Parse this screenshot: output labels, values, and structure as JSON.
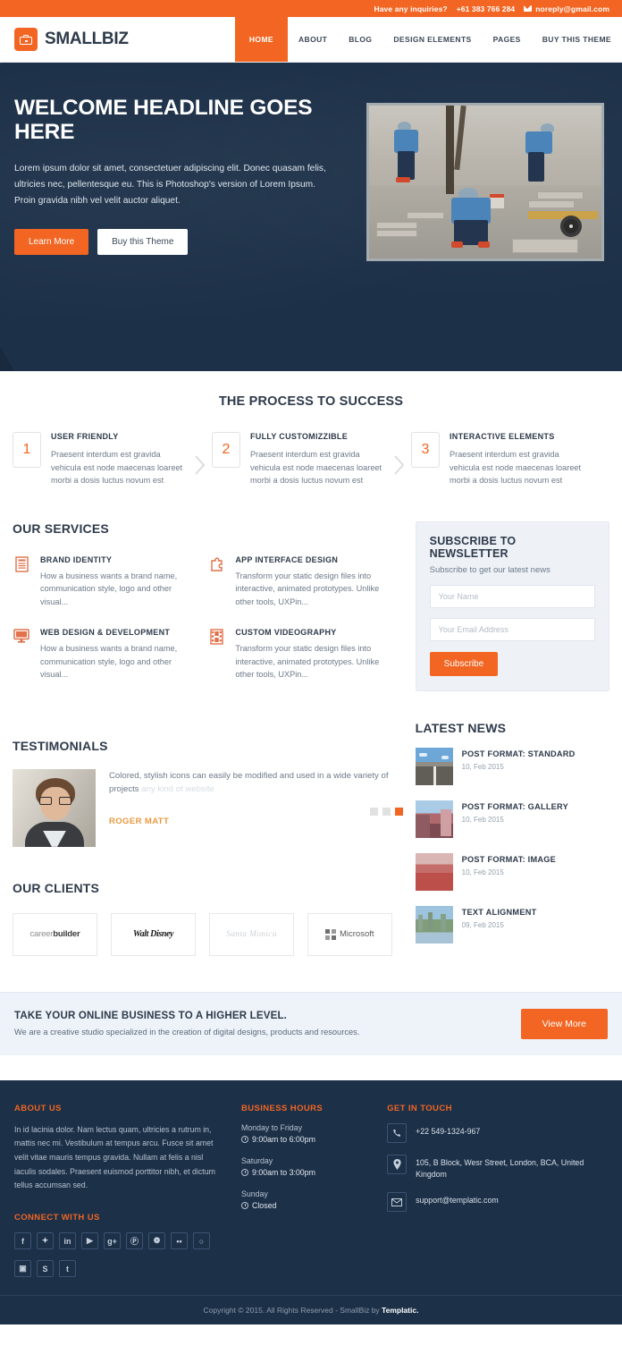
{
  "topbar": {
    "inquiry_label": "Have any inquiries?",
    "phone": "+61 383 766 284",
    "email": "noreply@gmail.com"
  },
  "header": {
    "logo_text": "SMALLBIZ",
    "nav": [
      {
        "label": "HOME",
        "active": true
      },
      {
        "label": "ABOUT",
        "active": false
      },
      {
        "label": "BLOG",
        "active": false
      },
      {
        "label": "DESIGN ELEMENTS",
        "active": false
      },
      {
        "label": "PAGES",
        "active": false
      },
      {
        "label": "BUY THIS THEME",
        "active": false
      }
    ]
  },
  "hero": {
    "title": "WELCOME HEADLINE GOES HERE",
    "description": "Lorem ipsum dolor sit amet, consectetuer adipiscing elit. Donec quasam felis, ultricies nec, pellentesque eu. This is Photoshop's version of Lorem Ipsum. Proin gravida nibh vel velit auctor aliquet.",
    "primary_btn": "Learn More",
    "secondary_btn": "Buy this Theme",
    "image_alt": "construction-workers-laying-pavers"
  },
  "process": {
    "title": "THE PROCESS TO SUCCESS",
    "items": [
      {
        "num": "1",
        "title": "USER FRIENDLY",
        "text": "Praesent interdum est gravida vehicula est node maecenas loareet morbi a dosis luctus novum est"
      },
      {
        "num": "2",
        "title": "FULLY CUSTOMIZZIBLE",
        "text": "Praesent interdum est gravida vehicula est node maecenas loareet morbi a dosis luctus novum est"
      },
      {
        "num": "3",
        "title": "INTERACTIVE ELEMENTS",
        "text": "Praesent interdum est gravida vehicula est node maecenas loareet morbi a dosis luctus novum est"
      }
    ]
  },
  "services": {
    "title": "OUR SERVICES",
    "items": [
      {
        "icon": "document-icon",
        "title": "BRAND IDENTITY",
        "text": "How a business wants a brand name, communication style, logo and other visual..."
      },
      {
        "icon": "puzzle-icon",
        "title": "APP INTERFACE DESIGN",
        "text": "Transform your static design files into interactive, animated prototypes. Unlike other tools, UXPin..."
      },
      {
        "icon": "monitor-icon",
        "title": "WEB DESIGN & DEVELOPMENT",
        "text": "How a business wants a brand name, communication style, logo and other visual..."
      },
      {
        "icon": "filmstrip-icon",
        "title": "CUSTOM VIDEOGRAPHY",
        "text": "Transform your static design files into interactive, animated prototypes. Unlike other tools, UXPin..."
      }
    ]
  },
  "newsletter": {
    "title": "SUBSCRIBE TO NEWSLETTER",
    "subtitle": "Subscribe to get our latest news",
    "name_placeholder": "Your Name",
    "email_placeholder": "Your Email Address",
    "name_value": "",
    "email_value": "",
    "button": "Subscribe"
  },
  "news": {
    "title": "LATEST NEWS",
    "items": [
      {
        "title": "POST FORMAT: STANDARD",
        "date": "10, Feb 2015",
        "thumb": "road-photo"
      },
      {
        "title": "POST FORMAT: GALLERY",
        "date": "10, Feb 2015",
        "thumb": "street-photo"
      },
      {
        "title": "POST FORMAT: IMAGE",
        "date": "10, Feb 2015",
        "thumb": "field-photo"
      },
      {
        "title": "TEXT ALIGNMENT",
        "date": "09, Feb 2015",
        "thumb": "city-photo"
      }
    ]
  },
  "testimonials": {
    "title": "TESTIMONIALS",
    "quote": "Colored, stylish icons can easily be modified and used in a wide variety of projects",
    "quote_faded": "any kind of website",
    "author": "ROGER MATT",
    "dots": 3,
    "active_dot": 3
  },
  "clients": {
    "title": "OUR CLIENTS",
    "items": [
      {
        "name_light": "career",
        "name_bold": "builder",
        "style": "careerbuilder"
      },
      {
        "name": "Walt Disney",
        "style": "disney"
      },
      {
        "name": "Santa Monica",
        "style": "santamonica"
      },
      {
        "name": "Microsoft",
        "style": "microsoft"
      }
    ]
  },
  "cta": {
    "title": "TAKE YOUR ONLINE BUSINESS TO A HIGHER LEVEL.",
    "subtitle": "We are a creative studio specialized in the creation of digital designs, products and resources.",
    "button": "View More"
  },
  "footer": {
    "about": {
      "title": "ABOUT US",
      "text": "In id lacinia dolor. Nam lectus quam, ultricies a rutrum in, mattis nec mi. Vestibulum at tempus arcu. Fusce sit amet velit vitae mauris tempus gravida. Nullam at felis a nisl iaculis sodales. Praesent euismod porttitor nibh, et dictum tellus accumsan sed."
    },
    "connect": {
      "title": "CONNECT WITH US",
      "socials": [
        {
          "name": "facebook",
          "glyph": "f"
        },
        {
          "name": "twitter",
          "glyph": "✦"
        },
        {
          "name": "linkedin",
          "glyph": "in"
        },
        {
          "name": "youtube",
          "glyph": "▶"
        },
        {
          "name": "google-plus",
          "glyph": "g+"
        },
        {
          "name": "pinterest",
          "glyph": "Ⓟ"
        },
        {
          "name": "dribbble",
          "glyph": "❁"
        },
        {
          "name": "flickr",
          "glyph": "••"
        },
        {
          "name": "github",
          "glyph": "○"
        },
        {
          "name": "instagram",
          "glyph": "▣"
        },
        {
          "name": "skype",
          "glyph": "S"
        },
        {
          "name": "tumblr",
          "glyph": "t"
        }
      ]
    },
    "hours": {
      "title": "BUSINESS HOURS",
      "items": [
        {
          "day": "Monday to Friday",
          "time": "9:00am to 6:00pm"
        },
        {
          "day": "Saturday",
          "time": "9:00am to 3:00pm"
        },
        {
          "day": "Sunday",
          "time": "Closed"
        }
      ]
    },
    "touch": {
      "title": "GET IN TOUCH",
      "items": [
        {
          "icon": "phone-icon",
          "text": "+22 549-1324-967"
        },
        {
          "icon": "location-pin-icon",
          "text": "105, B Block, Wesr Street, London, BCA, United Kingdom"
        },
        {
          "icon": "envelope-icon",
          "text": "support@templatic.com"
        }
      ]
    },
    "copyright_pre": "Copyright © 2015. All Rights Reserved - SmallBiz by ",
    "copyright_brand": "Templatic."
  },
  "colors": {
    "accent": "#f26522",
    "dark": "#1c3048",
    "heading": "#2e3a4a",
    "body_text": "#6d7a89",
    "light_bg": "#eef2f9"
  }
}
